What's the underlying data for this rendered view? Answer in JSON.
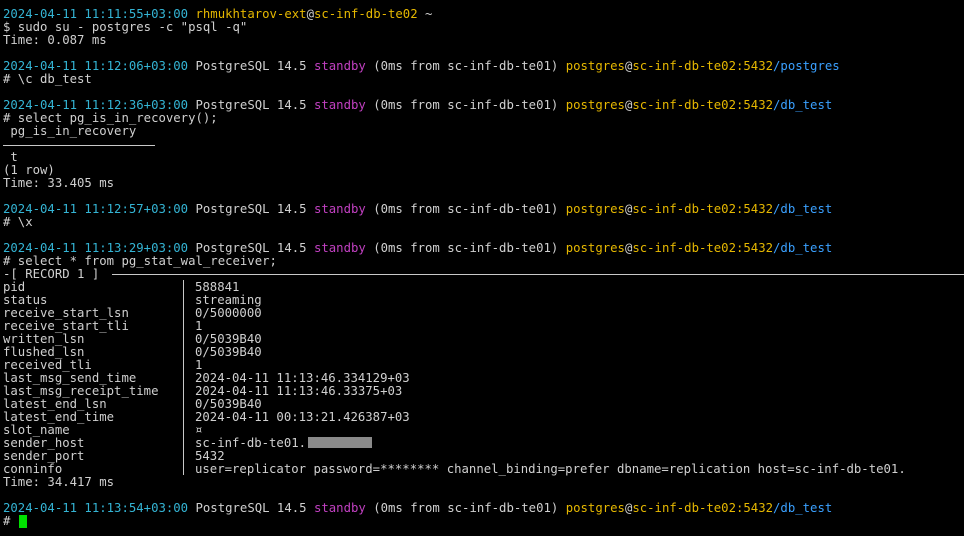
{
  "session": {
    "user": "rhmukhtarov-ext",
    "at": "@",
    "host": "sc-inf-db-te02",
    "tilde": "~",
    "command": "$ sudo su - postgres -c \"psql -q\"",
    "time0": "Time: 0.087 ms"
  },
  "prompt": {
    "server": "PostgreSQL 14.5",
    "standby": "standby",
    "from": "(0ms from sc-inf-db-te01)",
    "pg_user": "postgres",
    "pg_host": "sc-inf-db-te02",
    "port": ":5432"
  },
  "blocks": [
    {
      "date": "2024-04-11 11:12:06+03:00",
      "db": "/postgres",
      "cmd": "# \\c db_test"
    },
    {
      "date": "2024-04-11 11:12:36+03:00",
      "db": "/db_test",
      "cmd": "# select pg_is_in_recovery();"
    },
    {
      "date": "2024-04-11 11:12:57+03:00",
      "db": "/db_test",
      "cmd": "# \\x"
    },
    {
      "date": "2024-04-11 11:13:29+03:00",
      "db": "/db_test",
      "cmd": "# select * from pg_stat_wal_receiver;"
    },
    {
      "date": "2024-04-11 11:13:54+03:00",
      "db": "/db_test",
      "cmd": "#"
    }
  ],
  "first_date": "2024-04-11 11:11:55+03:00",
  "recovery": {
    "header": " pg_is_in_recovery",
    "value": " t",
    "rows": "(1 row)",
    "time": "Time: 33.405 ms"
  },
  "record": {
    "header": "-[ RECORD 1 ]",
    "fields": [
      {
        "key": "pid",
        "value": "588841"
      },
      {
        "key": "status",
        "value": "streaming"
      },
      {
        "key": "receive_start_lsn",
        "value": "0/5000000"
      },
      {
        "key": "receive_start_tli",
        "value": "1"
      },
      {
        "key": "written_lsn",
        "value": "0/5039B40"
      },
      {
        "key": "flushed_lsn",
        "value": "0/5039B40"
      },
      {
        "key": "received_tli",
        "value": "1"
      },
      {
        "key": "last_msg_send_time",
        "value": "2024-04-11 11:13:46.334129+03"
      },
      {
        "key": "last_msg_receipt_time",
        "value": "2024-04-11 11:13:46.33375+03"
      },
      {
        "key": "latest_end_lsn",
        "value": "0/5039B40"
      },
      {
        "key": "latest_end_time",
        "value": "2024-04-11 00:13:21.426387+03"
      },
      {
        "key": "slot_name",
        "value": "¤"
      },
      {
        "key": "sender_host",
        "value": "sc-inf-db-te01."
      },
      {
        "key": "sender_port",
        "value": "5432"
      },
      {
        "key": "conninfo",
        "value": "user=replicator password=******** channel_binding=prefer dbname=replication host=sc-inf-db-te01."
      }
    ],
    "time": "Time: 34.417 ms"
  }
}
